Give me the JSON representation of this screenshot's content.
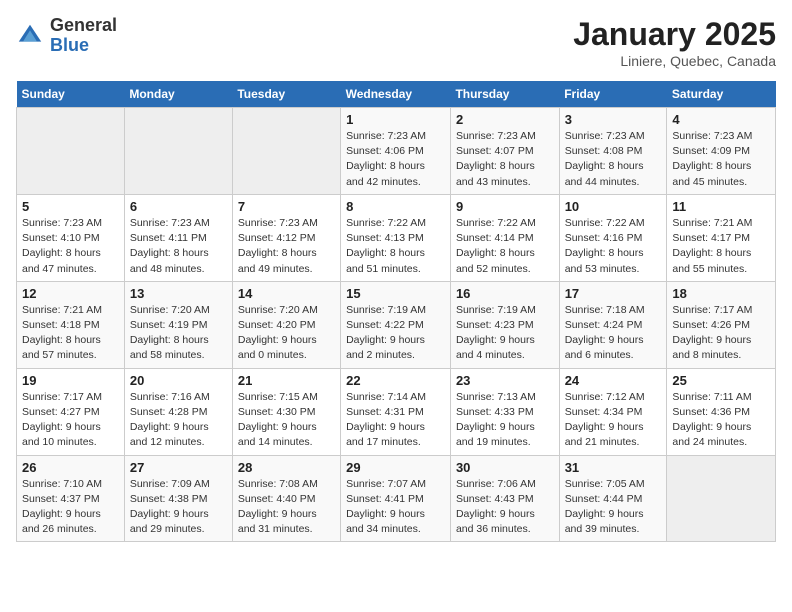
{
  "logo": {
    "general": "General",
    "blue": "Blue"
  },
  "title": "January 2025",
  "subtitle": "Liniere, Quebec, Canada",
  "headers": [
    "Sunday",
    "Monday",
    "Tuesday",
    "Wednesday",
    "Thursday",
    "Friday",
    "Saturday"
  ],
  "weeks": [
    [
      {
        "day": "",
        "info": ""
      },
      {
        "day": "",
        "info": ""
      },
      {
        "day": "",
        "info": ""
      },
      {
        "day": "1",
        "info": "Sunrise: 7:23 AM\nSunset: 4:06 PM\nDaylight: 8 hours and 42 minutes."
      },
      {
        "day": "2",
        "info": "Sunrise: 7:23 AM\nSunset: 4:07 PM\nDaylight: 8 hours and 43 minutes."
      },
      {
        "day": "3",
        "info": "Sunrise: 7:23 AM\nSunset: 4:08 PM\nDaylight: 8 hours and 44 minutes."
      },
      {
        "day": "4",
        "info": "Sunrise: 7:23 AM\nSunset: 4:09 PM\nDaylight: 8 hours and 45 minutes."
      }
    ],
    [
      {
        "day": "5",
        "info": "Sunrise: 7:23 AM\nSunset: 4:10 PM\nDaylight: 8 hours and 47 minutes."
      },
      {
        "day": "6",
        "info": "Sunrise: 7:23 AM\nSunset: 4:11 PM\nDaylight: 8 hours and 48 minutes."
      },
      {
        "day": "7",
        "info": "Sunrise: 7:23 AM\nSunset: 4:12 PM\nDaylight: 8 hours and 49 minutes."
      },
      {
        "day": "8",
        "info": "Sunrise: 7:22 AM\nSunset: 4:13 PM\nDaylight: 8 hours and 51 minutes."
      },
      {
        "day": "9",
        "info": "Sunrise: 7:22 AM\nSunset: 4:14 PM\nDaylight: 8 hours and 52 minutes."
      },
      {
        "day": "10",
        "info": "Sunrise: 7:22 AM\nSunset: 4:16 PM\nDaylight: 8 hours and 53 minutes."
      },
      {
        "day": "11",
        "info": "Sunrise: 7:21 AM\nSunset: 4:17 PM\nDaylight: 8 hours and 55 minutes."
      }
    ],
    [
      {
        "day": "12",
        "info": "Sunrise: 7:21 AM\nSunset: 4:18 PM\nDaylight: 8 hours and 57 minutes."
      },
      {
        "day": "13",
        "info": "Sunrise: 7:20 AM\nSunset: 4:19 PM\nDaylight: 8 hours and 58 minutes."
      },
      {
        "day": "14",
        "info": "Sunrise: 7:20 AM\nSunset: 4:20 PM\nDaylight: 9 hours and 0 minutes."
      },
      {
        "day": "15",
        "info": "Sunrise: 7:19 AM\nSunset: 4:22 PM\nDaylight: 9 hours and 2 minutes."
      },
      {
        "day": "16",
        "info": "Sunrise: 7:19 AM\nSunset: 4:23 PM\nDaylight: 9 hours and 4 minutes."
      },
      {
        "day": "17",
        "info": "Sunrise: 7:18 AM\nSunset: 4:24 PM\nDaylight: 9 hours and 6 minutes."
      },
      {
        "day": "18",
        "info": "Sunrise: 7:17 AM\nSunset: 4:26 PM\nDaylight: 9 hours and 8 minutes."
      }
    ],
    [
      {
        "day": "19",
        "info": "Sunrise: 7:17 AM\nSunset: 4:27 PM\nDaylight: 9 hours and 10 minutes."
      },
      {
        "day": "20",
        "info": "Sunrise: 7:16 AM\nSunset: 4:28 PM\nDaylight: 9 hours and 12 minutes."
      },
      {
        "day": "21",
        "info": "Sunrise: 7:15 AM\nSunset: 4:30 PM\nDaylight: 9 hours and 14 minutes."
      },
      {
        "day": "22",
        "info": "Sunrise: 7:14 AM\nSunset: 4:31 PM\nDaylight: 9 hours and 17 minutes."
      },
      {
        "day": "23",
        "info": "Sunrise: 7:13 AM\nSunset: 4:33 PM\nDaylight: 9 hours and 19 minutes."
      },
      {
        "day": "24",
        "info": "Sunrise: 7:12 AM\nSunset: 4:34 PM\nDaylight: 9 hours and 21 minutes."
      },
      {
        "day": "25",
        "info": "Sunrise: 7:11 AM\nSunset: 4:36 PM\nDaylight: 9 hours and 24 minutes."
      }
    ],
    [
      {
        "day": "26",
        "info": "Sunrise: 7:10 AM\nSunset: 4:37 PM\nDaylight: 9 hours and 26 minutes."
      },
      {
        "day": "27",
        "info": "Sunrise: 7:09 AM\nSunset: 4:38 PM\nDaylight: 9 hours and 29 minutes."
      },
      {
        "day": "28",
        "info": "Sunrise: 7:08 AM\nSunset: 4:40 PM\nDaylight: 9 hours and 31 minutes."
      },
      {
        "day": "29",
        "info": "Sunrise: 7:07 AM\nSunset: 4:41 PM\nDaylight: 9 hours and 34 minutes."
      },
      {
        "day": "30",
        "info": "Sunrise: 7:06 AM\nSunset: 4:43 PM\nDaylight: 9 hours and 36 minutes."
      },
      {
        "day": "31",
        "info": "Sunrise: 7:05 AM\nSunset: 4:44 PM\nDaylight: 9 hours and 39 minutes."
      },
      {
        "day": "",
        "info": ""
      }
    ]
  ]
}
